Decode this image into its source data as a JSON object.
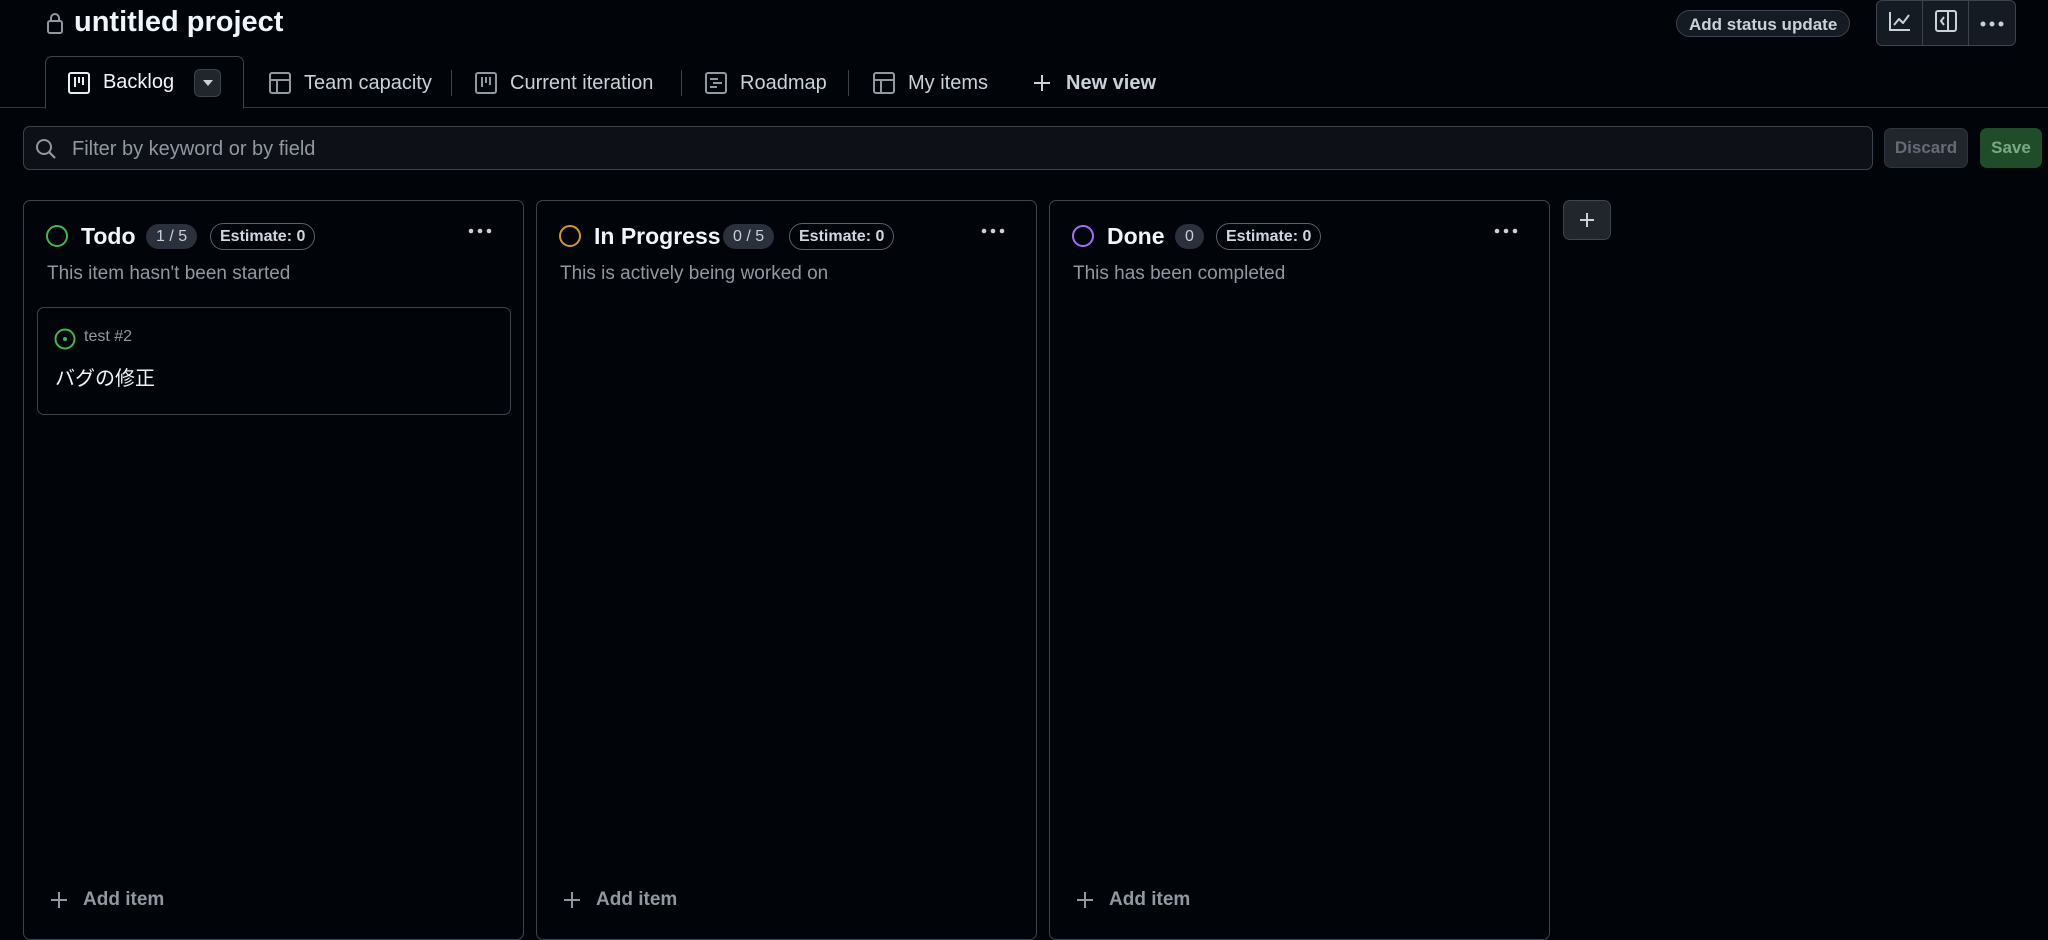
{
  "project": {
    "title": "untitled project",
    "status_update_label": "Add status update"
  },
  "toolbar": {
    "icons": [
      "insights-icon",
      "side-panel-icon",
      "kebab-horizontal-icon"
    ]
  },
  "tabs": [
    {
      "label": "Backlog",
      "icon": "board-icon",
      "active": true
    },
    {
      "label": "Team capacity",
      "icon": "table-icon"
    },
    {
      "label": "Current iteration",
      "icon": "board-icon"
    },
    {
      "label": "Roadmap",
      "icon": "roadmap-icon"
    },
    {
      "label": "My items",
      "icon": "table-icon"
    },
    {
      "label": "New view",
      "icon": "plus-icon"
    }
  ],
  "filter": {
    "placeholder": "Filter by keyword or by field",
    "discard_label": "Discard",
    "save_label": "Save"
  },
  "columns": [
    {
      "name": "Todo",
      "count": "1 / 5",
      "estimate": "Estimate: 0",
      "description": "This item hasn't been started",
      "color": "#3fb950",
      "add_label": "Add item",
      "cards": [
        {
          "ref": "test #2",
          "title": "バグの修正",
          "icon": "issue-opened-icon"
        }
      ]
    },
    {
      "name": "In Progress",
      "count": "0 / 5",
      "estimate": "Estimate: 0",
      "description": "This is actively being worked on",
      "color": "#d29922",
      "add_label": "Add item",
      "cards": []
    },
    {
      "name": "Done",
      "count": "0",
      "estimate": "Estimate: 0",
      "description": "This has been completed",
      "color": "#a371f7",
      "add_label": "Add item",
      "cards": []
    }
  ],
  "colors": {
    "background": "#010409",
    "border": "#3d444d",
    "text": "#f0f6fc",
    "muted": "#9198a1",
    "save": "#238636"
  }
}
